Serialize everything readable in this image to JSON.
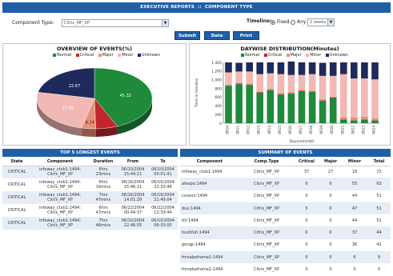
{
  "header": {
    "title": "EXECUTIVE REPORTS",
    "subtitle": "COMPONENT TYPE"
  },
  "filters": {
    "component_type_label": "Component Type:",
    "component_type_value": "Citrix_MF_XP",
    "timeline_label": "Timeline:",
    "timeline_options": [
      "Fixed",
      "Any"
    ],
    "timeline_selected": "Fixed",
    "timeline_value": "2 weeks"
  },
  "buttons": {
    "submit": "Submit",
    "data": "Data",
    "print": "Print"
  },
  "colors": {
    "normal": "#1e8a3a",
    "critical": "#c0262d",
    "major": "#e98f78",
    "minor": "#f2b8b4",
    "unknown": "#1f2a5c",
    "accent": "#1f5fa8"
  },
  "pie_panel": {
    "title": "OVERVIEW OF EVENTS(%)",
    "legend": [
      "Normal",
      "Critical",
      "Major",
      "Minor",
      "Unknown"
    ]
  },
  "bar_panel": {
    "title": "DAYWISE DISTRIBUTION(Minutes)",
    "legend": [
      "Normal",
      "Critical",
      "Major",
      "Minor",
      "Unknown"
    ],
    "ylabel": "Time in minutes",
    "xlabel": "Days(mm/dd)"
  },
  "chart_data": [
    {
      "type": "pie",
      "title": "OVERVIEW OF EVENTS(%)",
      "labels": [
        "Normal",
        "Critical",
        "Major",
        "Minor",
        "Unknown"
      ],
      "values": [
        45.32,
        6.4,
        4.14,
        25.68,
        22.67
      ],
      "value_labels": [
        "45.32",
        "",
        "4.14",
        "25.68",
        "22.67"
      ],
      "legend_placement": "top"
    },
    {
      "type": "bar",
      "stacked": true,
      "title": "DAYWISE DISTRIBUTION(Minutes)",
      "xlabel": "Days(mm/dd)",
      "ylabel": "Time in minutes",
      "categories": [
        "0610",
        "0611",
        "0612",
        "0613",
        "0614",
        "0615",
        "0616",
        "0617",
        "0618",
        "0619",
        "0620",
        "0621",
        "0622",
        "0623",
        "0624"
      ],
      "ylim": [
        0,
        1400
      ],
      "yticks": [
        0,
        200,
        400,
        600,
        800,
        1000,
        1200,
        1400
      ],
      "series": [
        {
          "name": "Normal",
          "values": [
            860,
            900,
            880,
            700,
            760,
            660,
            680,
            740,
            720,
            520,
            580,
            80,
            60,
            80,
            60
          ]
        },
        {
          "name": "Critical",
          "values": [
            10,
            10,
            10,
            10,
            10,
            10,
            10,
            10,
            10,
            10,
            10,
            10,
            10,
            10,
            10
          ]
        },
        {
          "name": "Major",
          "values": [
            20,
            20,
            20,
            20,
            20,
            20,
            20,
            20,
            20,
            20,
            20,
            40,
            60,
            60,
            40
          ]
        },
        {
          "name": "Minor",
          "values": [
            280,
            260,
            280,
            400,
            360,
            440,
            400,
            340,
            380,
            540,
            480,
            1000,
            900,
            880,
            900
          ]
        },
        {
          "name": "Unknown",
          "values": [
            230,
            200,
            210,
            270,
            250,
            270,
            310,
            290,
            270,
            300,
            310,
            270,
            370,
            370,
            390
          ]
        }
      ],
      "legend_placement": "top"
    }
  ],
  "longest_events": {
    "title": "TOP 5 LONGEST EVENTS",
    "columns": [
      "State",
      "Component",
      "Duration",
      "From",
      "To"
    ],
    "rows": [
      {
        "state": "CRITICAL",
        "component": [
          "infoway_ctxb1:1494:",
          "Citrix_MF_XP"
        ],
        "duration": [
          "6hrs",
          "23mins"
        ],
        "from": [
          "06/10/2004",
          "15:44:11"
        ],
        "to": [
          "06/10/2004",
          "00:01:41"
        ]
      },
      {
        "state": "CRITICAL",
        "component": [
          "infoway_ctxb1:1494:",
          "Citrix_MF_XP"
        ],
        "duration": [
          "6hrs",
          "16mins"
        ],
        "from": [
          "06/16/2004",
          "15:46:21"
        ],
        "to": [
          "06/16/2004",
          "22:33:48"
        ]
      },
      {
        "state": "CRITICAL",
        "component": [
          "infoway_ctxb1:1494:",
          "Citrix_MF_XP"
        ],
        "duration": [
          "7hrs",
          "47mins"
        ],
        "from": [
          "06/16/2004",
          "14:01:29"
        ],
        "to": [
          "06/16/2004",
          "21:49:04"
        ]
      },
      {
        "state": "CRITICAL",
        "component": [
          "infoway_ctxb1:1494:",
          "Citrix_MF_XP"
        ],
        "duration": [
          "6hrs",
          "47mins"
        ],
        "from": [
          "06/22/2004",
          "00:44:37"
        ],
        "to": [
          "06/22/2004",
          "12:33:44"
        ]
      },
      {
        "state": "CRITICAL",
        "component": [
          "infoway_ctxb1:1494:",
          "Citrix_MF_XP"
        ],
        "duration": [
          "7hrs",
          "46mins"
        ],
        "from": [
          "06/10/2004",
          "22:46:55"
        ],
        "to": [
          "06/10/2004",
          "06:33:05"
        ]
      }
    ]
  },
  "summary": {
    "title": "SUMMARY OF EVENTS",
    "columns": [
      "Component",
      "Comp.Type",
      "Critical",
      "Major",
      "Minor",
      "Total"
    ],
    "rows": [
      [
        "infoway_ctxb1:1494",
        "Citrix_MF_XP",
        "37",
        "27",
        "18",
        "72"
      ],
      [
        "afexpo:1494",
        "Citrix_MF_XP",
        "0",
        "0",
        "55",
        "63"
      ],
      [
        "cvosxir:1494",
        "Citrix_MF_XP",
        "0",
        "0",
        "44",
        "51"
      ],
      [
        "dux:1494",
        "Citrix_MF_XP",
        "5",
        "0",
        "47",
        "51"
      ],
      [
        "tfz:1494",
        "Citrix_MF_XP",
        "0",
        "0",
        "44",
        "51"
      ],
      [
        "hushfuh:1494",
        "Citrix_MF_XP",
        "0",
        "0",
        "37",
        "44"
      ],
      [
        "gocqp:1494",
        "Citrix_MF_XP",
        "0",
        "0",
        "36",
        "42"
      ],
      [
        "fmnabaframe1:1494",
        "Citrix_MF_XP",
        "0",
        "0",
        "6",
        "9"
      ],
      [
        "fmnabaframe2:1494",
        "Citrix_MF_XP",
        "0",
        "0",
        "0",
        "0"
      ]
    ]
  }
}
